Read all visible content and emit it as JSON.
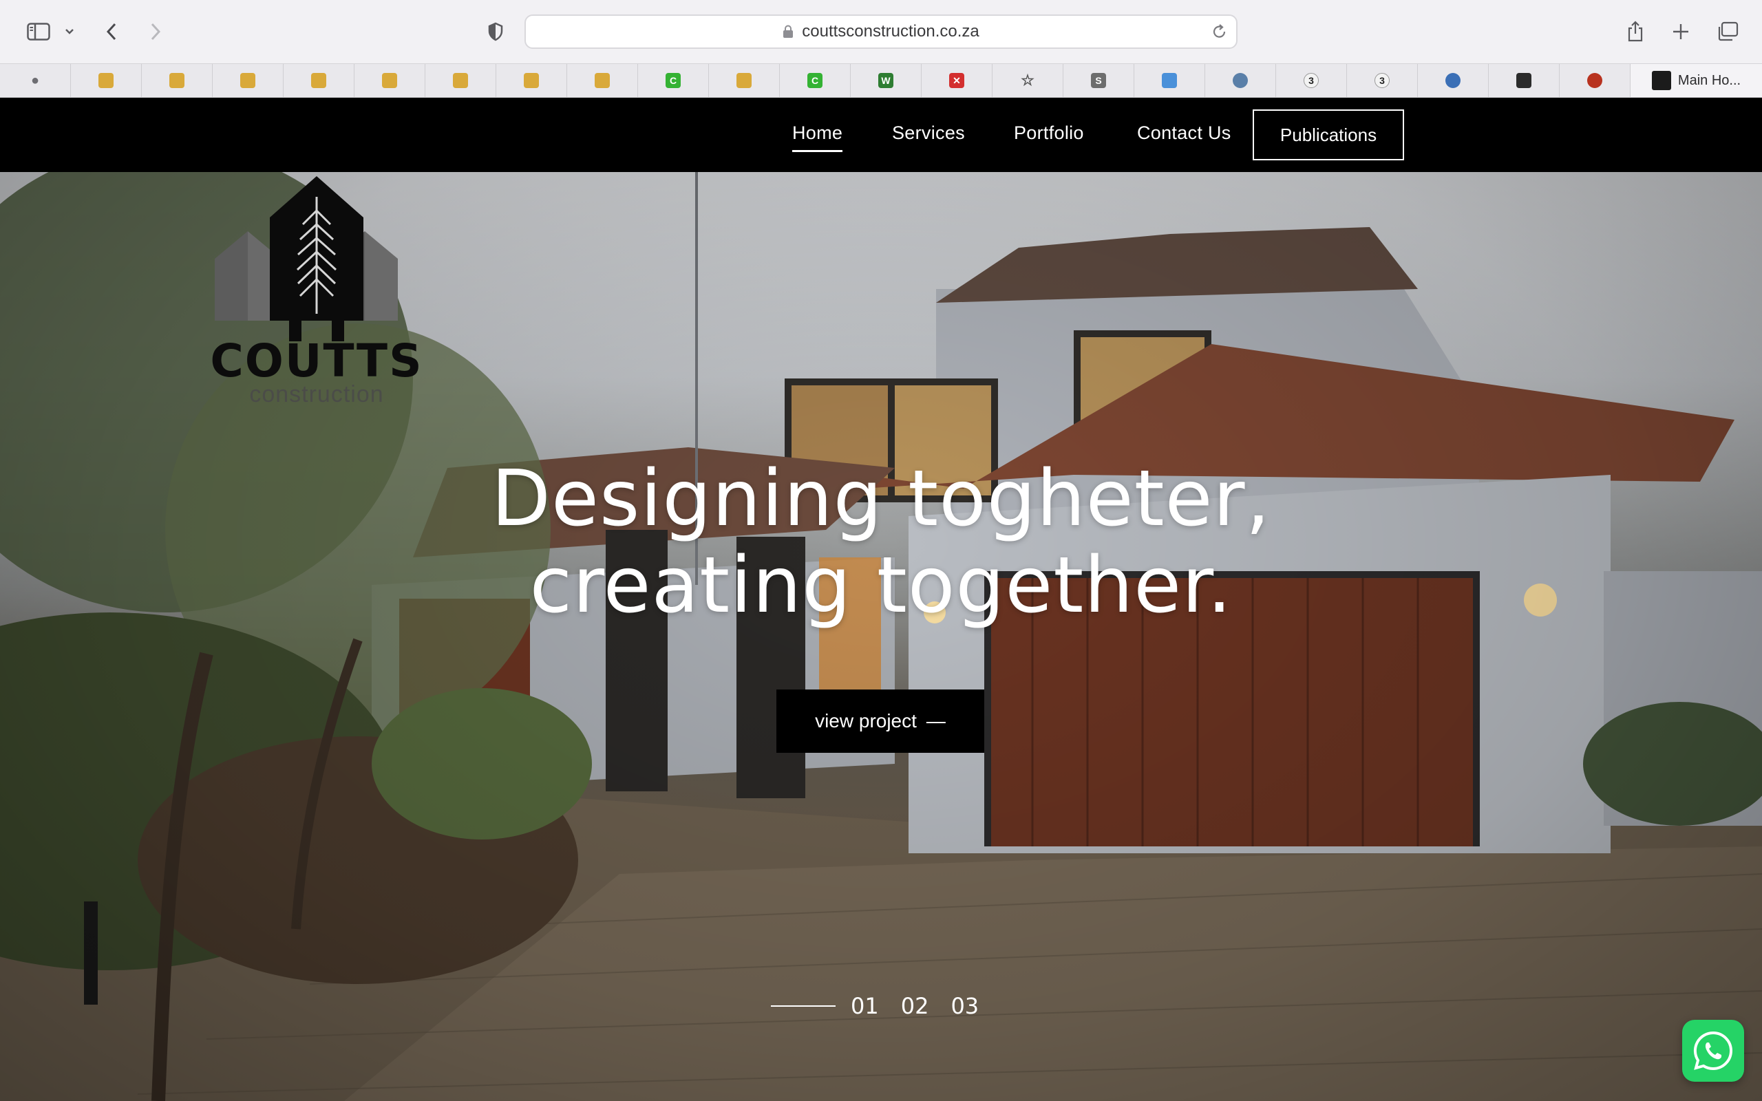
{
  "browser": {
    "url": "couttsconstruction.co.za",
    "bookmarks": [
      {
        "icon": "apple-icon"
      },
      {
        "icon": "cap-logo-icon"
      },
      {
        "icon": "cap-logo-icon"
      },
      {
        "icon": "cap-logo-icon"
      },
      {
        "icon": "cap-logo-icon"
      },
      {
        "icon": "cap-logo-icon"
      },
      {
        "icon": "cap-logo-icon"
      },
      {
        "icon": "cap-logo-icon"
      },
      {
        "icon": "cap-logo-icon"
      },
      {
        "icon": "green-c-icon"
      },
      {
        "icon": "cap-logo-icon"
      },
      {
        "icon": "green-c-icon"
      },
      {
        "icon": "w-logo-icon"
      },
      {
        "icon": "red-shield-icon"
      },
      {
        "icon": "star-icon"
      },
      {
        "icon": "s-logo-icon"
      },
      {
        "icon": "cube-icon"
      },
      {
        "icon": "dots-icon"
      },
      {
        "icon": "e-logo-icon"
      },
      {
        "icon": "e-logo-icon"
      },
      {
        "icon": "circle-logo-icon"
      },
      {
        "icon": "house-logo-icon"
      },
      {
        "icon": "red-ball-icon"
      }
    ],
    "main_bookmark": "Main Ho..."
  },
  "nav": {
    "home": "Home",
    "services": "Services",
    "portfolio": "Portfolio",
    "contact": "Contact Us",
    "publications": "Publications"
  },
  "logo": {
    "word": "COUTTS",
    "sub": "construction"
  },
  "hero": {
    "headline_line1": "Designing togheter,",
    "headline_line2": "creating together.",
    "cta": "view project",
    "cta_arrow": "—",
    "slides": [
      "01",
      "02",
      "03"
    ]
  },
  "colors": {
    "nav_bg": "#000000",
    "whatsapp": "#25d366"
  }
}
